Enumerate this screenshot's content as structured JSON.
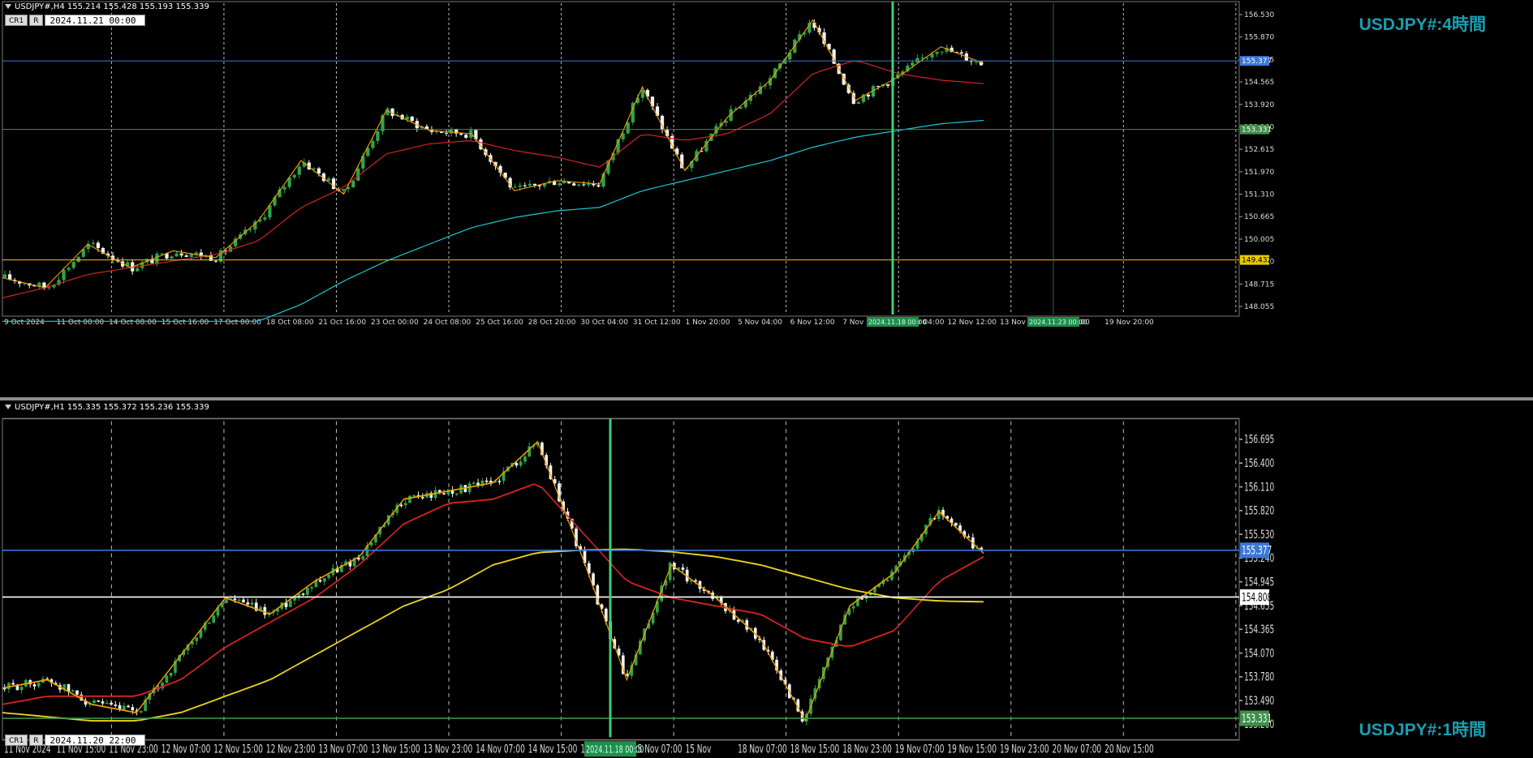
{
  "top": {
    "header": "USDJPY#,H4  155.214 155.428 155.193 155.339",
    "buttons": [
      "CR1",
      "R"
    ],
    "datetime": "2024.11.21 00:00",
    "big_label": "USDJPY#:4時間",
    "price_axis": [
      "156.530",
      "155.870",
      "155.225",
      "154.565",
      "153.920",
      "153.260",
      "152.615",
      "151.970",
      "151.310",
      "150.665",
      "150.005",
      "149.360",
      "148.715",
      "148.055"
    ],
    "time_axis": [
      "9 Oct 2024",
      "11 Oct 00:00",
      "14 Oct 08:00",
      "15 Oct 16:00",
      "17 Oct 00:00",
      "18 Oct 08:00",
      "21 Oct 16:00",
      "23 Oct 00:00",
      "24 Oct 08:00",
      "25 Oct 16:00",
      "28 Oct 20:00",
      "30 Oct 04:00",
      "31 Oct 12:00",
      "1 Nov 20:00",
      "5 Nov 04:00",
      "6 Nov 12:00",
      "7 Nov 20:00",
      "11 Nov 04:00",
      "12 Nov 12:00",
      "13 Nov 20:00",
      "Nov 12:00",
      "19 Nov 20:00"
    ],
    "markers": {
      "vline_label": "2024.11.18 00:00",
      "vline2_label": "2024.11.23 00:00"
    },
    "lines": {
      "blue": {
        "label": "155.377",
        "value": 155.377
      },
      "green": {
        "label": "153.331",
        "value": 153.331
      },
      "yellow": {
        "label": "149.432",
        "value": 149.432
      }
    }
  },
  "bottom": {
    "header": "USDJPY#,H1  155.335 155.372 155.236 155.339",
    "buttons": [
      "CR1",
      "R"
    ],
    "datetime": "2024.11.20 22:00",
    "big_label": "USDJPY#:1時間",
    "price_axis": [
      "156.695",
      "156.400",
      "156.110",
      "155.820",
      "155.530",
      "155.240",
      "154.945",
      "154.655",
      "154.365",
      "154.070",
      "153.780",
      "153.490",
      "153.200"
    ],
    "time_axis": [
      "11 Nov 2024",
      "11 Nov 15:00",
      "11 Nov 23:00",
      "12 Nov 07:00",
      "12 Nov 15:00",
      "12 Nov 23:00",
      "13 Nov 07:00",
      "13 Nov 15:00",
      "13 Nov 23:00",
      "14 Nov 07:00",
      "14 Nov 15:00",
      "14 Nov 23:00",
      "15 Nov 07:00",
      "15 Nov",
      "18 Nov 07:00",
      "18 Nov 15:00",
      "18 Nov 23:00",
      "19 Nov 07:00",
      "19 Nov 15:00",
      "19 Nov 23:00",
      "20 Nov 07:00",
      "20 Nov 15:00"
    ],
    "markers": {
      "vline_label": "2024.11.18 00:00"
    },
    "lines": {
      "blue": {
        "label": "155.377",
        "value": 155.377
      },
      "white": {
        "label": "154.808",
        "value": 154.808
      },
      "green": {
        "label": "153.331",
        "value": 153.331
      }
    }
  },
  "colors": {
    "up": "#2ca64d",
    "down": "#f2f2f2",
    "ma_red": "#d42323",
    "ma_cyan": "#19c8d6",
    "ma_yellow": "#e8d21c",
    "zigzag": "#f0a000",
    "vline": "#3ecf7a",
    "hline_blue": "#3a78d8",
    "hline_green": "#3f8f4a",
    "hline_yellow": "#e8c800",
    "hline_white": "#ffffff",
    "grid": "#bdbdbd"
  },
  "chart_data": [
    {
      "type": "line",
      "title": "USDJPY#,H4",
      "x": [
        "9 Oct 2024",
        "11 Oct 00:00",
        "14 Oct 08:00",
        "15 Oct 16:00",
        "17 Oct 00:00",
        "18 Oct 08:00",
        "21 Oct 16:00",
        "23 Oct 00:00",
        "24 Oct 08:00",
        "25 Oct 16:00",
        "28 Oct 20:00",
        "30 Oct 04:00",
        "31 Oct 12:00",
        "1 Nov 20:00",
        "5 Nov 04:00",
        "6 Nov 12:00",
        "7 Nov 20:00",
        "11 Nov 04:00",
        "12 Nov 12:00",
        "13 Nov 20:00",
        "18 Nov 00:00",
        "Nov 12:00",
        "19 Nov 20:00",
        "21 Nov 00:00"
      ],
      "ylim": [
        147.8,
        157.1
      ],
      "series": [
        {
          "values": [
            148.9,
            148.6,
            149.9,
            149.2,
            149.7,
            149.5,
            150.6,
            152.4,
            151.4,
            153.9,
            153.3,
            153.2,
            151.5,
            151.8,
            151.7,
            154.6,
            152.1,
            153.7,
            154.8,
            156.6,
            154.2,
            154.9,
            155.8,
            155.3
          ]
        },
        {
          "values": [
            148.3,
            148.6,
            149.0,
            149.2,
            149.4,
            149.6,
            150.0,
            151.0,
            151.6,
            152.6,
            152.9,
            153.0,
            152.7,
            152.5,
            152.2,
            153.2,
            153.0,
            153.2,
            153.8,
            155.0,
            155.4,
            155.0,
            154.8,
            154.7
          ]
        },
        {
          "values": [
            147.6,
            147.6,
            147.6,
            147.6,
            147.6,
            147.6,
            147.6,
            148.1,
            148.8,
            149.4,
            149.9,
            150.4,
            150.7,
            150.9,
            151.0,
            151.5,
            151.8,
            152.1,
            152.4,
            152.8,
            153.1,
            153.3,
            153.5,
            153.6
          ]
        }
      ]
    },
    {
      "type": "line",
      "title": "USDJPY#,H1",
      "x": [
        "11 Nov 2024",
        "11 Nov 15:00",
        "11 Nov 23:00",
        "12 Nov 07:00",
        "12 Nov 15:00",
        "12 Nov 23:00",
        "13 Nov 07:00",
        "13 Nov 15:00",
        "13 Nov 23:00",
        "14 Nov 07:00",
        "14 Nov 15:00",
        "14 Nov 23:00",
        "15 Nov 07:00",
        "15 Nov",
        "18 Nov 07:00",
        "18 Nov 15:00",
        "18 Nov 23:00",
        "19 Nov 07:00",
        "19 Nov 15:00",
        "19 Nov 23:00",
        "20 Nov 07:00",
        "20 Nov 15:00",
        "20 Nov 22:00"
      ],
      "ylim": [
        153.1,
        156.95
      ],
      "series": [
        {
          "values": [
            153.7,
            153.8,
            153.5,
            153.4,
            154.1,
            154.8,
            154.6,
            155.0,
            155.3,
            156.0,
            156.1,
            156.2,
            156.7,
            155.3,
            153.8,
            155.2,
            154.8,
            154.3,
            153.3,
            154.7,
            155.1,
            155.85,
            155.34
          ]
        },
        {
          "values": [
            153.5,
            153.6,
            153.6,
            153.6,
            153.8,
            154.2,
            154.5,
            154.8,
            155.2,
            155.7,
            155.95,
            156.0,
            156.2,
            155.6,
            155.0,
            154.8,
            154.7,
            154.6,
            154.3,
            154.2,
            154.4,
            155.0,
            155.3
          ]
        },
        {
          "values": [
            153.4,
            153.35,
            153.3,
            153.3,
            153.4,
            153.6,
            153.8,
            154.1,
            154.4,
            154.7,
            154.9,
            155.2,
            155.35,
            155.38,
            155.39,
            155.36,
            155.3,
            155.2,
            155.05,
            154.9,
            154.8,
            154.76,
            154.75
          ]
        }
      ]
    }
  ]
}
